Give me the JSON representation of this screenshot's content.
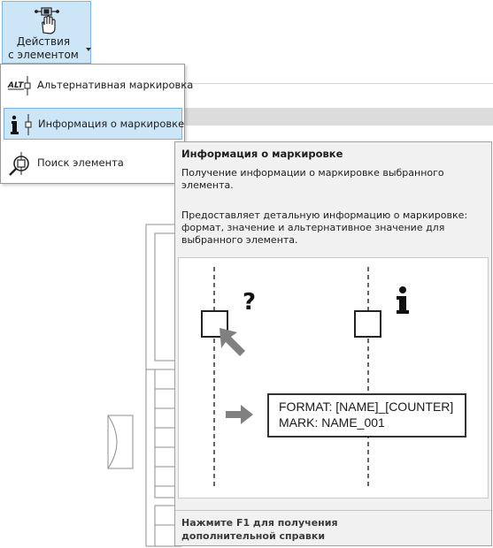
{
  "ribbon": {
    "actions_button": {
      "label": "Действия\nс элементом",
      "icon": "hand-element-icon"
    }
  },
  "menu": {
    "items": [
      {
        "label": "Альтернативная маркировка",
        "icon": "alt-marking-icon",
        "selected": false
      },
      {
        "label": "Информация о маркировке",
        "icon": "marking-info-icon",
        "selected": true
      },
      {
        "label": "Поиск элемента",
        "icon": "find-element-icon",
        "selected": false
      }
    ]
  },
  "tooltip": {
    "title": "Информация о маркировке",
    "summary": "Получение информации о маркировке выбранного элемента.",
    "description": "Предоставляет детальную информацию о маркировке: формат, значение и альтернативное значение для выбранного элемента.",
    "illustration": {
      "question_mark": "?",
      "info_mark": "i",
      "format_line": "FORMAT: [NAME]_[COUNTER]",
      "mark_line": "MARK:  NAME_001"
    },
    "footer": "Нажмите F1 для получения\nдополнительной справки"
  },
  "colors": {
    "selection_bg": "#cde6f7",
    "selection_border": "#7fb1de",
    "tooltip_bg": "#f1f1f1",
    "arrow_gray": "#808080"
  }
}
